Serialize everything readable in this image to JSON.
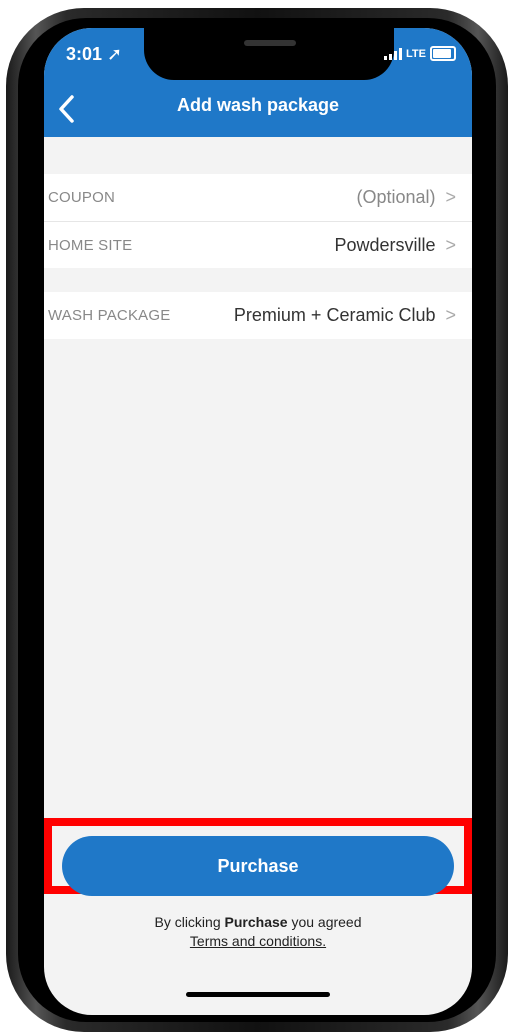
{
  "status_bar": {
    "time": "3:01",
    "network": "LTE"
  },
  "header": {
    "title": "Add wash package"
  },
  "form": {
    "coupon": {
      "label": "COUPON",
      "value": "(Optional)"
    },
    "home_site": {
      "label": "HOME SITE",
      "value": "Powdersville"
    },
    "wash_package": {
      "label": "WASH PACKAGE",
      "value": "Premium + Ceramic Club"
    }
  },
  "purchase": {
    "button_label": "Purchase",
    "agreement_prefix": "By clicking",
    "agreement_bold": "Purchase",
    "agreement_suffix": "you agreed",
    "terms_link": "Terms and conditions."
  },
  "colors": {
    "brand": "#1f78c8",
    "highlight": "#ff0000"
  }
}
